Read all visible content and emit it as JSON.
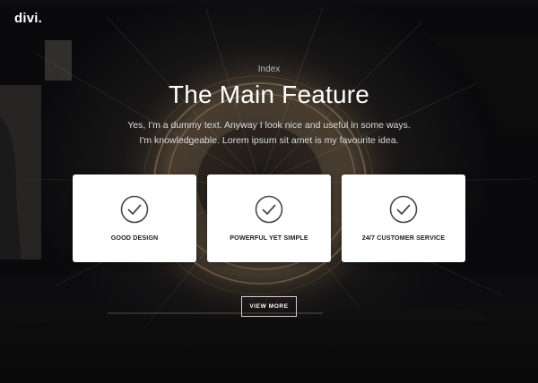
{
  "brand": {
    "logo": "divi."
  },
  "hero": {
    "eyebrow": "Index",
    "title": "The Main Feature",
    "subtitle_line1": "Yes, I'm a dummy text. Anyway I look nice and useful in some ways.",
    "subtitle_line2": "I'm knowledgeable. Lorem ipsum sit amet is my favourite idea."
  },
  "features": [
    {
      "label": "GOOD DESIGN",
      "icon": "check-circle-icon"
    },
    {
      "label": "POWERFUL YET SIMPLE",
      "icon": "check-circle-icon"
    },
    {
      "label": "24/7 CUSTOMER SERVICE",
      "icon": "check-circle-icon"
    }
  ],
  "cta": {
    "label": "VIEW MORE"
  },
  "colors": {
    "background": "#141314",
    "card": "#ffffff",
    "text_primary": "#ffffff",
    "icon_stroke": "#4a4a4a",
    "button_border": "#cfcfcf"
  }
}
